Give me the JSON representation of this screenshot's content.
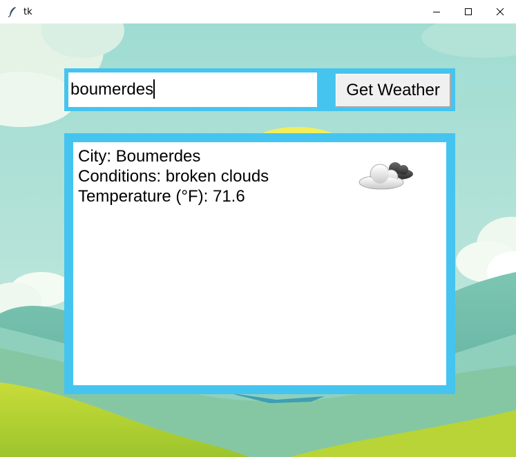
{
  "window": {
    "title": "tk",
    "app_icon": "feather-icon",
    "controls": [
      "minimize-icon",
      "maximize-icon",
      "close-icon"
    ]
  },
  "search": {
    "value": "boumerdes",
    "button_label": "Get Weather"
  },
  "result": {
    "lines": [
      "City: Boumerdes",
      "Conditions: broken clouds",
      "Temperature (°F): 71.6"
    ],
    "icon": "broken-clouds-icon"
  },
  "colors": {
    "frame": "#45c4ef",
    "sky": "#a6ddd3",
    "hills_dark": "#5fb3a6",
    "grass": "#b9d534"
  }
}
